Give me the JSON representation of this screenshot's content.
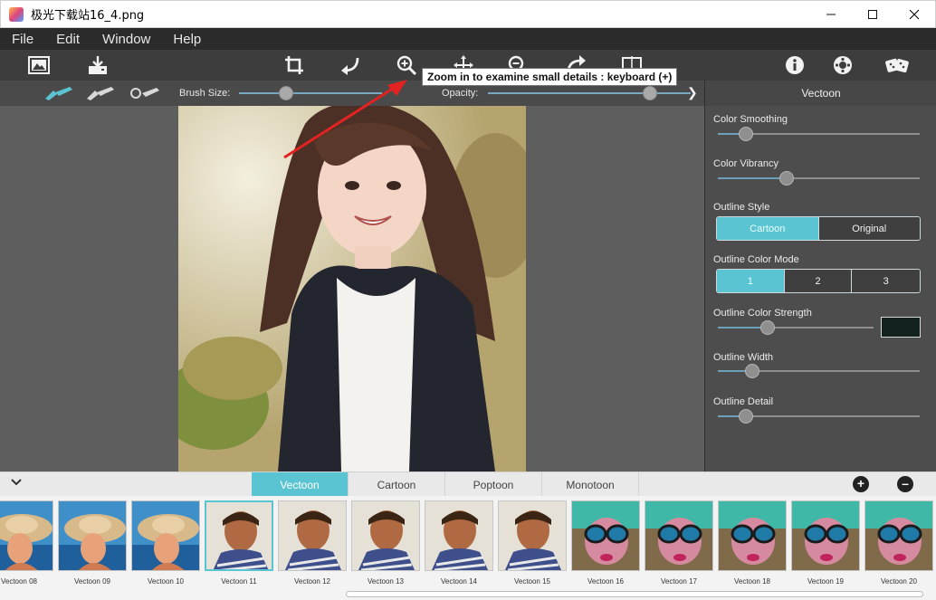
{
  "window": {
    "title": "极光下载站16_4.png",
    "controls": [
      "minimize-icon",
      "maximize-icon",
      "close-icon"
    ]
  },
  "menu": [
    "File",
    "Edit",
    "Window",
    "Help"
  ],
  "toolbar": {
    "left_tools": [
      "open-image-icon",
      "save-image-icon"
    ],
    "center_tools": [
      "crop-icon",
      "undo-icon",
      "zoom-in-icon",
      "pan-icon",
      "zoom-out-icon",
      "redo-icon",
      "compare-icon"
    ],
    "right_tools": [
      "info-icon",
      "settings-icon",
      "random-dice-icon"
    ],
    "tooltip": "Zoom in to examine small details : keyboard (+)"
  },
  "brush": {
    "tools": [
      "brush-paint-icon",
      "brush-erase-icon",
      "brush-reset-icon"
    ],
    "size_label": "Brush Size:",
    "size_value": 0.33,
    "opacity_label": "Opacity:",
    "opacity_value": 0.8
  },
  "panel": {
    "title": "Vectoon",
    "color_smoothing": {
      "label": "Color Smoothing",
      "value": 0.14
    },
    "color_vibrancy": {
      "label": "Color Vibrancy",
      "value": 0.34
    },
    "outline_style": {
      "label": "Outline Style",
      "options": [
        "Cartoon",
        "Original"
      ],
      "selected": "Cartoon"
    },
    "outline_color_mode": {
      "label": "Outline Color Mode",
      "options": [
        "1",
        "2",
        "3"
      ],
      "selected": "1"
    },
    "outline_color_strength": {
      "label": "Outline Color Strength",
      "value": 0.32,
      "swatch": "#14221f"
    },
    "outline_width": {
      "label": "Outline Width",
      "value": 0.17
    },
    "outline_detail": {
      "label": "Outline Detail",
      "value": 0.14
    }
  },
  "preset_tabs": {
    "items": [
      "Vectoon",
      "Cartoon",
      "Poptoon",
      "Monotoon"
    ],
    "selected": "Vectoon",
    "add_icon": "plus-icon",
    "remove_icon": "minus-icon",
    "collapse_icon": "chevron-down-icon"
  },
  "thumbnails": [
    {
      "label": "Vectoon 08",
      "kind": "hat"
    },
    {
      "label": "Vectoon 09",
      "kind": "hat"
    },
    {
      "label": "Vectoon 10",
      "kind": "hat"
    },
    {
      "label": "Vectoon 11",
      "kind": "man",
      "selected": true
    },
    {
      "label": "Vectoon 12",
      "kind": "man"
    },
    {
      "label": "Vectoon 13",
      "kind": "man"
    },
    {
      "label": "Vectoon 14",
      "kind": "man"
    },
    {
      "label": "Vectoon 15",
      "kind": "man"
    },
    {
      "label": "Vectoon 16",
      "kind": "goggles"
    },
    {
      "label": "Vectoon 17",
      "kind": "goggles"
    },
    {
      "label": "Vectoon 18",
      "kind": "goggles"
    },
    {
      "label": "Vectoon 19",
      "kind": "goggles"
    },
    {
      "label": "Vectoon 20",
      "kind": "goggles"
    }
  ]
}
